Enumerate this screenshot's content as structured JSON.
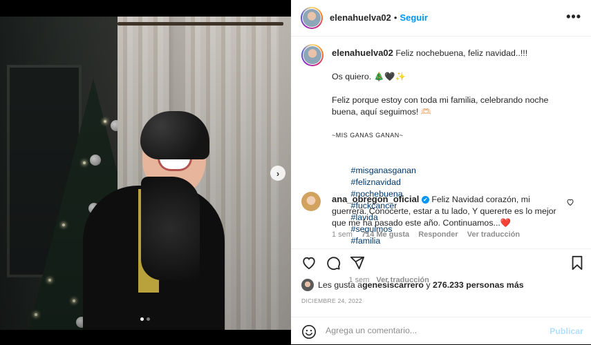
{
  "post": {
    "author": "elenahuelva02",
    "follow_label": "Seguir",
    "more_glyph": "•••",
    "carousel": {
      "next_glyph": "›",
      "slides": 2,
      "active": 1
    }
  },
  "caption": {
    "author": "elenahuelva02",
    "lines": [
      "Feliz nochebuena, feliz navidad..!!!",
      "",
      "Os quiero. 🎄🖤✨",
      "",
      "Feliz porque estoy con toda mi familia, celebrando noche buena, aquí seguimos! 🫶🏻",
      "",
      "~MIS GANAS GANAN~",
      ""
    ],
    "hashtags": [
      "#misganasganan",
      "#feliznavidad",
      "#nochebuena",
      "#fuckcancer",
      "#lavida",
      "#seguimos",
      "#familia"
    ],
    "time": "1 sem",
    "translate": "Ver traducción"
  },
  "comment": {
    "author": "ana_obregon_oficial",
    "verified_glyph": "✔",
    "text": "Feliz Navidad corazón, mi guerrera. Conocerte, estar a tu lado, Y quererte es lo mejor que me ha pasado este año. Continuamos...❤️",
    "time": "1 sem",
    "likes": "714 Me gusta",
    "reply": "Responder",
    "translate": "Ver traducción"
  },
  "likes": {
    "prefix": "Les gusta a ",
    "user": "genesiscarrero",
    "middle": " y ",
    "count": "276.233 personas más"
  },
  "date": "DICIEMBRE 24, 2022",
  "composer": {
    "placeholder": "Agrega un comentario...",
    "publish": "Publicar"
  },
  "colors": {
    "link": "#0095f6",
    "hashtag": "#00376b",
    "secondary": "#8e8e8e",
    "publish_disabled": "#b2dffc",
    "heart": "#ed4956"
  },
  "icons": [
    "more-icon",
    "next-arrow-icon",
    "heart-icon",
    "comment-icon",
    "share-icon",
    "bookmark-icon",
    "emoji-icon",
    "verified-icon",
    "comment-like-icon"
  ]
}
